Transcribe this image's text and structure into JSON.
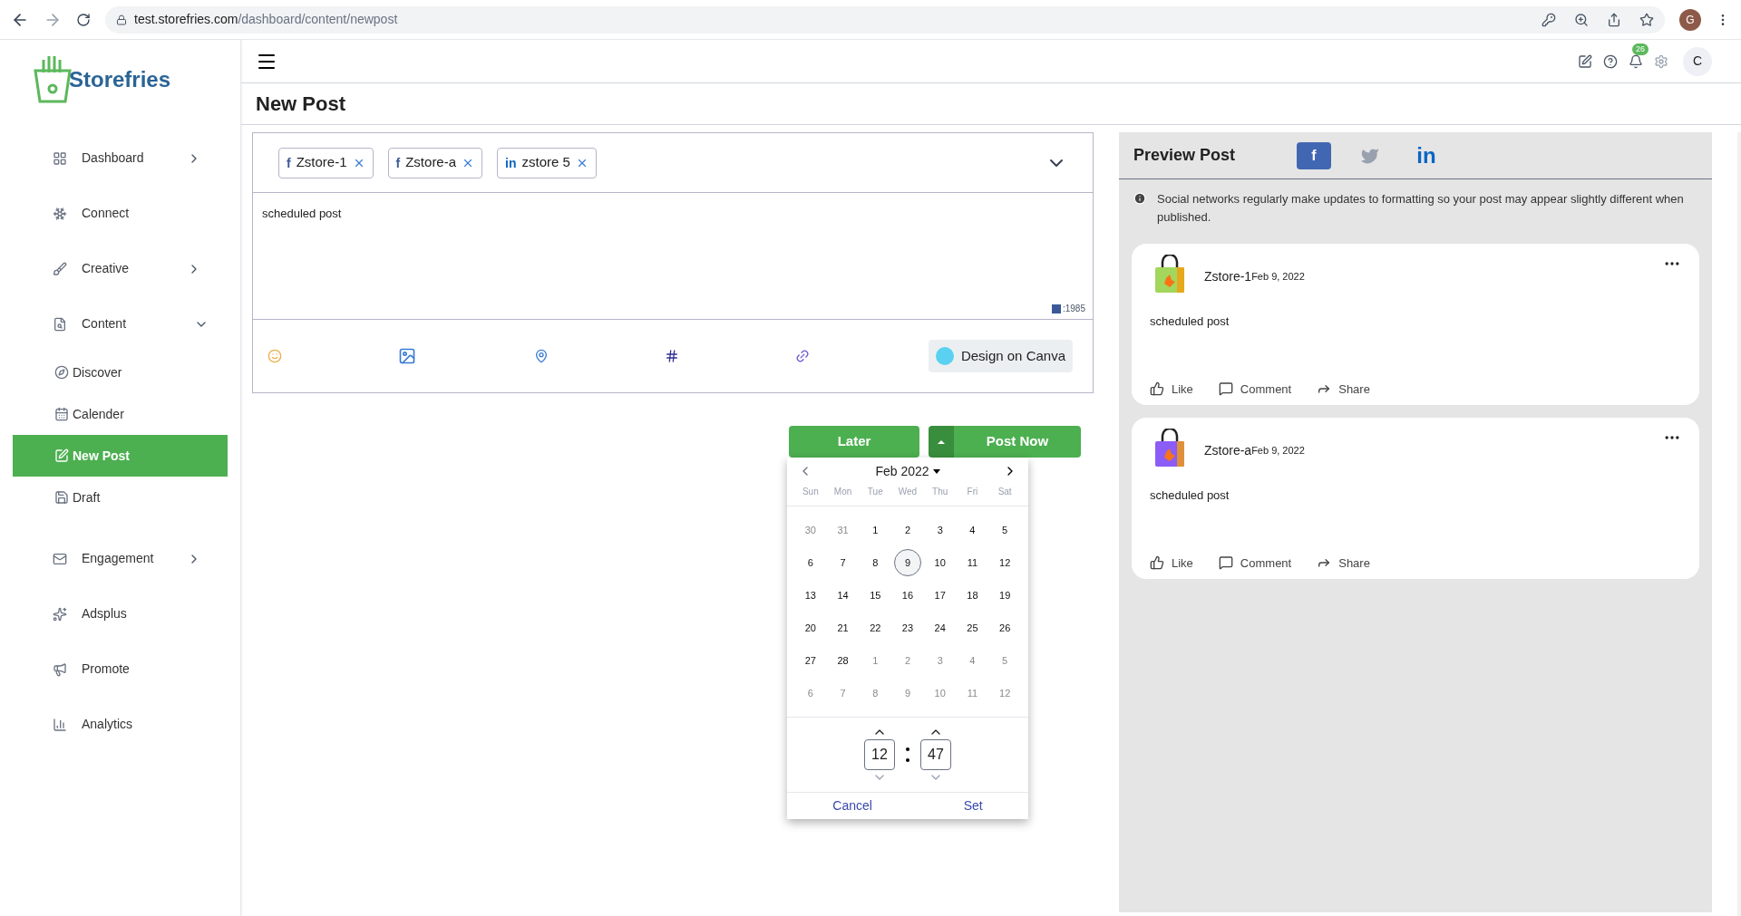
{
  "browser": {
    "url_host": "test.storefries.com",
    "url_path": "/dashboard/content/newpost",
    "profile": "G"
  },
  "brand": {
    "name": "Storefries"
  },
  "sidebar": {
    "items": [
      {
        "label": "Dashboard",
        "selected": false
      },
      {
        "label": "Connect",
        "selected": false
      },
      {
        "label": "Creative",
        "selected": false
      },
      {
        "label": "Content",
        "expanded": true,
        "selected": false
      },
      {
        "label": "Discover",
        "selected": false
      },
      {
        "label": "Calender",
        "selected": false
      },
      {
        "label": "New Post",
        "selected": true
      },
      {
        "label": "Draft",
        "selected": false
      },
      {
        "label": "Engagement",
        "selected": false
      },
      {
        "label": "Adsplus",
        "selected": false
      },
      {
        "label": "Promote",
        "selected": false
      },
      {
        "label": "Analytics",
        "selected": false
      }
    ]
  },
  "header": {
    "notifications": "26",
    "avatar": "C"
  },
  "page_title": "New Post",
  "accounts": [
    {
      "kind": "facebook",
      "glyph": "f",
      "name": "Zstore-1"
    },
    {
      "kind": "facebook",
      "glyph": "f",
      "name": "Zstore-a"
    },
    {
      "kind": "linkedin",
      "glyph": "in",
      "name": "zstore 5"
    }
  ],
  "post_text": "scheduled post",
  "char_count": ":1985",
  "canva_button": "Design on Canva",
  "later_button": "Later",
  "post_now_button": "Post Now",
  "datepicker": {
    "month": "Feb 2022",
    "weekdays": [
      "Sun",
      "Mon",
      "Tue",
      "Wed",
      "Thu",
      "Fri",
      "Sat"
    ],
    "weeks": [
      [
        {
          "label": "30",
          "muted": true,
          "selected": false
        },
        {
          "label": "31",
          "muted": true,
          "selected": false
        },
        {
          "label": "1",
          "muted": false,
          "selected": false
        },
        {
          "label": "2",
          "muted": false,
          "selected": false
        },
        {
          "label": "3",
          "muted": false,
          "selected": false
        },
        {
          "label": "4",
          "muted": false,
          "selected": false
        },
        {
          "label": "5",
          "muted": false,
          "selected": false
        }
      ],
      [
        {
          "label": "6",
          "muted": false,
          "selected": false
        },
        {
          "label": "7",
          "muted": false,
          "selected": false
        },
        {
          "label": "8",
          "muted": false,
          "selected": false
        },
        {
          "label": "9",
          "muted": false,
          "selected": true
        },
        {
          "label": "10",
          "muted": false,
          "selected": false
        },
        {
          "label": "11",
          "muted": false,
          "selected": false
        },
        {
          "label": "12",
          "muted": false,
          "selected": false
        }
      ],
      [
        {
          "label": "13",
          "muted": false,
          "selected": false
        },
        {
          "label": "14",
          "muted": false,
          "selected": false
        },
        {
          "label": "15",
          "muted": false,
          "selected": false
        },
        {
          "label": "16",
          "muted": false,
          "selected": false
        },
        {
          "label": "17",
          "muted": false,
          "selected": false
        },
        {
          "label": "18",
          "muted": false,
          "selected": false
        },
        {
          "label": "19",
          "muted": false,
          "selected": false
        }
      ],
      [
        {
          "label": "20",
          "muted": false,
          "selected": false
        },
        {
          "label": "21",
          "muted": false,
          "selected": false
        },
        {
          "label": "22",
          "muted": false,
          "selected": false
        },
        {
          "label": "23",
          "muted": false,
          "selected": false
        },
        {
          "label": "24",
          "muted": false,
          "selected": false
        },
        {
          "label": "25",
          "muted": false,
          "selected": false
        },
        {
          "label": "26",
          "muted": false,
          "selected": false
        }
      ],
      [
        {
          "label": "27",
          "muted": false,
          "selected": false
        },
        {
          "label": "28",
          "muted": false,
          "selected": false
        },
        {
          "label": "1",
          "muted": true,
          "selected": false
        },
        {
          "label": "2",
          "muted": true,
          "selected": false
        },
        {
          "label": "3",
          "muted": true,
          "selected": false
        },
        {
          "label": "4",
          "muted": true,
          "selected": false
        },
        {
          "label": "5",
          "muted": true,
          "selected": false
        }
      ],
      [
        {
          "label": "6",
          "muted": true,
          "selected": false
        },
        {
          "label": "7",
          "muted": true,
          "selected": false
        },
        {
          "label": "8",
          "muted": true,
          "selected": false
        },
        {
          "label": "9",
          "muted": true,
          "selected": false
        },
        {
          "label": "10",
          "muted": true,
          "selected": false
        },
        {
          "label": "11",
          "muted": true,
          "selected": false
        },
        {
          "label": "12",
          "muted": true,
          "selected": false
        }
      ]
    ],
    "hour": "12",
    "minute": "47",
    "cancel": "Cancel",
    "set": "Set"
  },
  "preview": {
    "title": "Preview Post",
    "tabs": [
      {
        "kind": "facebook",
        "glyph": "f",
        "selected": true
      },
      {
        "kind": "twitter",
        "selected": false
      },
      {
        "kind": "linkedin",
        "glyph": "in",
        "selected": false
      }
    ],
    "notice": "Social networks regularly make updates to formatting so your post may appear slightly different when published.",
    "posts": [
      {
        "account": "Zstore-1",
        "date": "Feb 9, 2022",
        "text": "scheduled post",
        "actions": [
          "Like",
          "Comment",
          "Share"
        ]
      },
      {
        "account": "Zstore-a",
        "date": "Feb 9, 2022",
        "text": "scheduled post",
        "actions": [
          "Like",
          "Comment",
          "Share"
        ]
      }
    ]
  }
}
